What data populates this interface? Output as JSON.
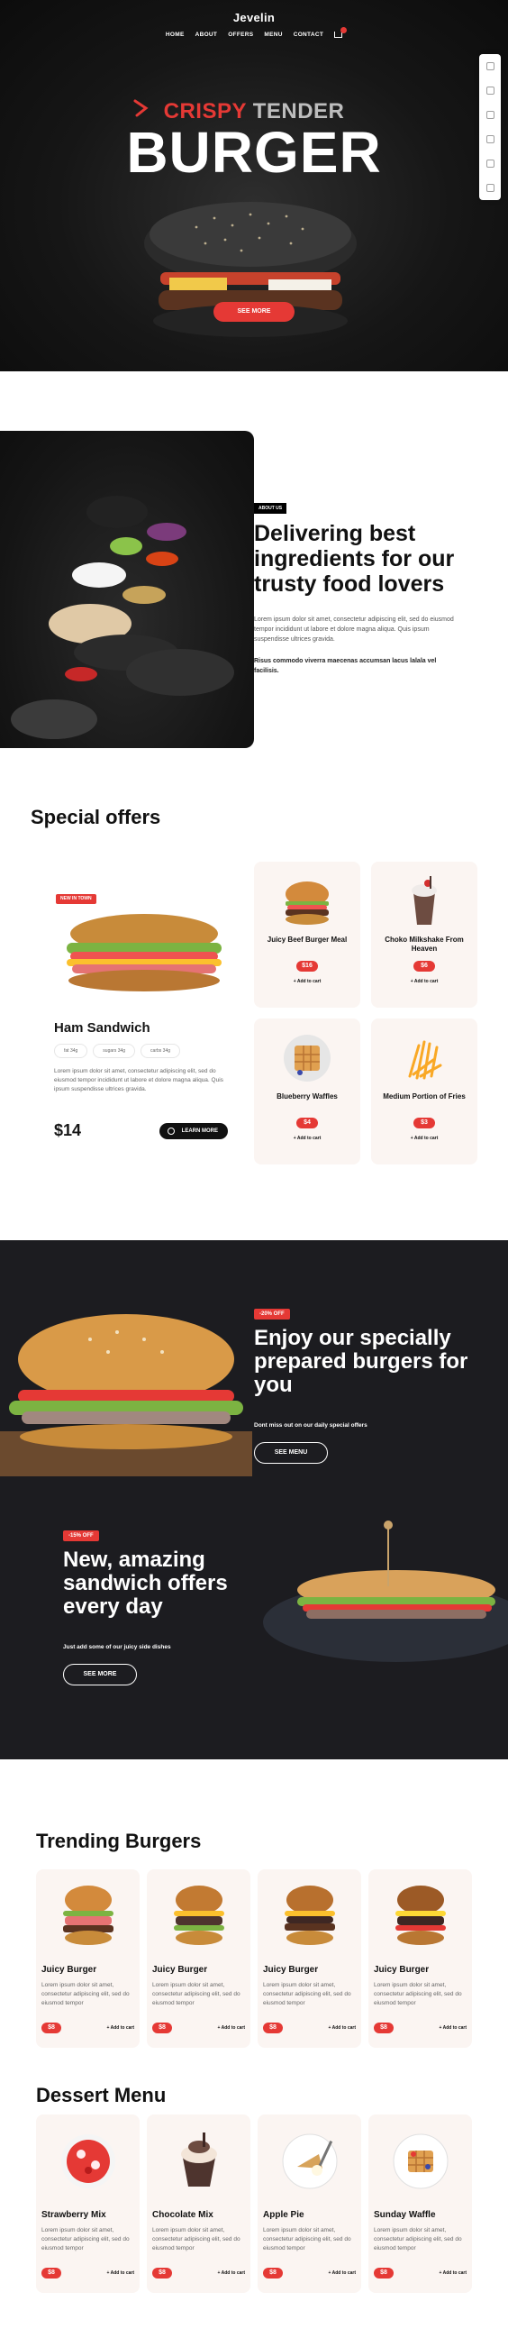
{
  "header": {
    "brand": "Jevelin",
    "nav": [
      "HOME",
      "ABOUT",
      "OFFERS",
      "MENU",
      "CONTACT"
    ]
  },
  "hero": {
    "kicker_red": "CRISPY",
    "kicker_gray": "TENDER",
    "title": "BURGER",
    "button": "SEE MORE"
  },
  "about": {
    "tag": "ABOUT US",
    "title": "Delivering best ingredients for our trusty food lovers",
    "p1": "Lorem ipsum dolor sit amet, consectetur adipiscing elit, sed do eiusmod tempor incididunt ut labore et dolore magna aliqua. Quis ipsum suspendisse ultrices gravida.",
    "p2": "Risus commodo viverra maecenas accumsan lacus lalala vel facilisis."
  },
  "offers": {
    "title": "Special offers",
    "featured": {
      "badge": "NEW IN TOWN",
      "name": "Ham Sandwich",
      "tags": [
        "fat 34g",
        "sugars 34g",
        "carbs 34g"
      ],
      "description": "Lorem ipsum dolor sit amet, consectetur adipiscing elit, sed do eiusmod tempor incididunt ut labore et dolore magna aliqua. Quis ipsum suspendisse ultrices gravida.",
      "price": "$14",
      "button": "LEARN MORE"
    },
    "items": [
      {
        "name": "Juicy Beef Burger Meal",
        "price": "$16",
        "cart": "Add to cart"
      },
      {
        "name": "Choko Milkshake From Heaven",
        "price": "$6",
        "cart": "Add to cart"
      },
      {
        "name": "Blueberry Waffles",
        "price": "$4",
        "cart": "Add to cart"
      },
      {
        "name": "Medium Portion of Fries",
        "price": "$3",
        "cart": "Add to cart"
      }
    ]
  },
  "promo": {
    "a": {
      "badge": "-20% OFF",
      "title": "Enjoy our specially prepared burgers for you",
      "sub": "Dont miss out on our daily special offers",
      "button": "SEE MENU"
    },
    "b": {
      "badge": "-15% OFF",
      "title": "New, amazing sandwich offers every day",
      "sub": "Just add some of our juicy side dishes",
      "button": "SEE MORE"
    }
  },
  "trending": {
    "title": "Trending Burgers",
    "items": [
      {
        "name": "Juicy Burger",
        "desc": "Lorem ipsum dolor sit amet, consectetur adipiscing elit, sed do eiusmod tempor",
        "price": "$8",
        "cart": "Add to cart"
      },
      {
        "name": "Juicy Burger",
        "desc": "Lorem ipsum dolor sit amet, consectetur adipiscing elit, sed do eiusmod tempor",
        "price": "$8",
        "cart": "Add to cart"
      },
      {
        "name": "Juicy Burger",
        "desc": "Lorem ipsum dolor sit amet, consectetur adipiscing elit, sed do eiusmod tempor",
        "price": "$8",
        "cart": "Add to cart"
      },
      {
        "name": "Juicy Burger",
        "desc": "Lorem ipsum dolor sit amet, consectetur adipiscing elit, sed do eiusmod tempor",
        "price": "$8",
        "cart": "Add to cart"
      }
    ]
  },
  "desserts": {
    "title": "Dessert Menu",
    "items": [
      {
        "name": "Strawberry Mix",
        "desc": "Lorem ipsum dolor sit amet, consectetur adipiscing elit, sed do eiusmod tempor",
        "price": "$8",
        "cart": "Add to cart"
      },
      {
        "name": "Chocolate Mix",
        "desc": "Lorem ipsum dolor sit amet, consectetur adipiscing elit, sed do eiusmod tempor",
        "price": "$8",
        "cart": "Add to cart"
      },
      {
        "name": "Apple Pie",
        "desc": "Lorem ipsum dolor sit amet, consectetur adipiscing elit, sed do eiusmod tempor",
        "price": "$8",
        "cart": "Add to cart"
      },
      {
        "name": "Sunday Waffle",
        "desc": "Lorem ipsum dolor sit amet, consectetur adipiscing elit, sed do eiusmod tempor",
        "price": "$8",
        "cart": "Add to cart"
      }
    ]
  },
  "colors": {
    "accent": "#e53935",
    "dark": "#1c1c20",
    "card": "#fbf5f2"
  }
}
